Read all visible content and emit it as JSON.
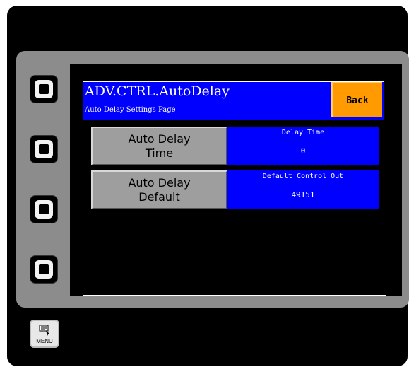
{
  "header": {
    "title": "ADV.CTRL.AutoDelay",
    "subtitle": "Auto Delay Settings Page",
    "back_label": "Back"
  },
  "settings": [
    {
      "button_line1": "Auto Delay",
      "button_line2": "Time",
      "field_label": "Delay Time",
      "field_value": "0"
    },
    {
      "button_line1": "Auto Delay",
      "button_line2": "Default",
      "field_label": "Default Control Out",
      "field_value": "49151"
    }
  ],
  "menu": {
    "label": "MENU",
    "icon": "menu-icon"
  },
  "side_buttons": {
    "count": 4,
    "icon": "square-key-icon"
  },
  "colors": {
    "header_bg": "#0000ff",
    "back_button": "#ff9a00",
    "setting_button": "#9e9e9e",
    "bezel": "#8c8c8c",
    "screen_bg": "#000000"
  }
}
